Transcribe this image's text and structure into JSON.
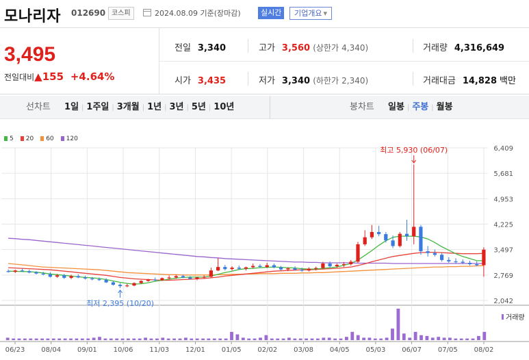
{
  "header": {
    "stock_name": "모나리자",
    "stock_code": "012690",
    "market_badge": "코스피",
    "date": "2024.08.09",
    "date_suffix": "기준(장마감)",
    "realtime_label": "실시간",
    "company_button": "기업개요",
    "company_button_arrow": "▾"
  },
  "quote": {
    "price": "3,495",
    "change_label": "전일대비",
    "change_arrow": "▲",
    "change_value": "155",
    "change_pct": "+4.64%",
    "prev_close_label": "전일",
    "prev_close": "3,340",
    "high_label": "고가",
    "high": "3,560",
    "upper_limit_label": "(상한가",
    "upper_limit": "4,340)",
    "volume_label": "거래량",
    "volume": "4,316,649",
    "open_label": "시가",
    "open": "3,435",
    "low_label": "저가",
    "low": "3,340",
    "lower_limit_label": "(하한가",
    "lower_limit": "2,340)",
    "amount_label": "거래대금",
    "amount": "14,828",
    "amount_unit": "백만"
  },
  "tabs": {
    "line_chart_label": "선차트",
    "line_periods": [
      "1일",
      "1주일",
      "3개월",
      "1년",
      "3년",
      "5년",
      "10년"
    ],
    "candle_label": "봉차트",
    "candle_periods": [
      "일봉",
      "주봉",
      "월봉"
    ],
    "active_candle": "주봉"
  },
  "colors": {
    "up": "#e0211b",
    "down": "#3a7be0",
    "ma5": "#41b83f",
    "ma20": "#e8413a",
    "ma60": "#f4903a",
    "ma120": "#9a64cf",
    "volume": "#9c6bd3",
    "accent": "#3e6fd1"
  },
  "chart_data": {
    "type": "candlestick",
    "interval": "weekly",
    "legend": [
      {
        "name": "5",
        "color": "#41b83f"
      },
      {
        "name": "20",
        "color": "#e8413a"
      },
      {
        "name": "60",
        "color": "#f4903a"
      },
      {
        "name": "120",
        "color": "#9a64cf"
      }
    ],
    "x_tick_labels": [
      "06/23",
      "08/04",
      "09/01",
      "10/06",
      "11/03",
      "12/01",
      "01/05",
      "02/02",
      "03/08",
      "04/05",
      "05/03",
      "06/07",
      "07/05",
      "08/02"
    ],
    "y_tick_labels": [
      "6,409",
      "5,681",
      "4,953",
      "4,225",
      "3,497",
      "2,769",
      "2,042"
    ],
    "ylim": [
      2042,
      6409
    ],
    "annotations": [
      {
        "label": "최고 5,930 (06/07)",
        "value": 5930
      },
      {
        "label": "최저 2,395 (10/20)",
        "value": 2395
      }
    ],
    "volume_label": "거래량",
    "ohlc": [
      {
        "o": 2880,
        "h": 2930,
        "l": 2840,
        "c": 2860
      },
      {
        "o": 2860,
        "h": 2920,
        "l": 2830,
        "c": 2900
      },
      {
        "o": 2900,
        "h": 2960,
        "l": 2860,
        "c": 2880
      },
      {
        "o": 2880,
        "h": 2920,
        "l": 2820,
        "c": 2840
      },
      {
        "o": 2850,
        "h": 2880,
        "l": 2790,
        "c": 2810
      },
      {
        "o": 2810,
        "h": 2860,
        "l": 2760,
        "c": 2790
      },
      {
        "o": 2790,
        "h": 2850,
        "l": 2700,
        "c": 2720
      },
      {
        "o": 2720,
        "h": 2800,
        "l": 2690,
        "c": 2760
      },
      {
        "o": 2760,
        "h": 2800,
        "l": 2660,
        "c": 2690
      },
      {
        "o": 2690,
        "h": 2780,
        "l": 2650,
        "c": 2740
      },
      {
        "o": 2740,
        "h": 2790,
        "l": 2680,
        "c": 2700
      },
      {
        "o": 2700,
        "h": 2750,
        "l": 2640,
        "c": 2670
      },
      {
        "o": 2670,
        "h": 2710,
        "l": 2620,
        "c": 2650
      },
      {
        "o": 2650,
        "h": 2700,
        "l": 2600,
        "c": 2630
      },
      {
        "o": 2630,
        "h": 2680,
        "l": 2540,
        "c": 2560
      },
      {
        "o": 2560,
        "h": 2600,
        "l": 2470,
        "c": 2490
      },
      {
        "o": 2490,
        "h": 2540,
        "l": 2395,
        "c": 2450
      },
      {
        "o": 2450,
        "h": 2520,
        "l": 2420,
        "c": 2470
      },
      {
        "o": 2470,
        "h": 2560,
        "l": 2450,
        "c": 2540
      },
      {
        "o": 2540,
        "h": 2620,
        "l": 2520,
        "c": 2600
      },
      {
        "o": 2600,
        "h": 2660,
        "l": 2580,
        "c": 2640
      },
      {
        "o": 2640,
        "h": 2700,
        "l": 2600,
        "c": 2620
      },
      {
        "o": 2620,
        "h": 2700,
        "l": 2600,
        "c": 2680
      },
      {
        "o": 2680,
        "h": 2760,
        "l": 2640,
        "c": 2700
      },
      {
        "o": 2700,
        "h": 2780,
        "l": 2660,
        "c": 2740
      },
      {
        "o": 2740,
        "h": 2780,
        "l": 2680,
        "c": 2700
      },
      {
        "o": 2700,
        "h": 2740,
        "l": 2640,
        "c": 2660
      },
      {
        "o": 2660,
        "h": 2720,
        "l": 2620,
        "c": 2700
      },
      {
        "o": 2700,
        "h": 2760,
        "l": 2660,
        "c": 2720
      },
      {
        "o": 2720,
        "h": 2980,
        "l": 2700,
        "c": 2900
      },
      {
        "o": 2900,
        "h": 3250,
        "l": 2880,
        "c": 3000
      },
      {
        "o": 3000,
        "h": 3060,
        "l": 2900,
        "c": 2940
      },
      {
        "o": 2940,
        "h": 3020,
        "l": 2900,
        "c": 2980
      },
      {
        "o": 2980,
        "h": 3040,
        "l": 2920,
        "c": 2950
      },
      {
        "o": 2950,
        "h": 3010,
        "l": 2900,
        "c": 2990
      },
      {
        "o": 2990,
        "h": 3100,
        "l": 2960,
        "c": 3030
      },
      {
        "o": 3030,
        "h": 3080,
        "l": 2980,
        "c": 3000
      },
      {
        "o": 3000,
        "h": 3120,
        "l": 2970,
        "c": 3050
      },
      {
        "o": 3050,
        "h": 3100,
        "l": 2960,
        "c": 2990
      },
      {
        "o": 2990,
        "h": 3030,
        "l": 2900,
        "c": 2930
      },
      {
        "o": 2930,
        "h": 2990,
        "l": 2880,
        "c": 2960
      },
      {
        "o": 2960,
        "h": 3020,
        "l": 2900,
        "c": 2920
      },
      {
        "o": 2920,
        "h": 2980,
        "l": 2860,
        "c": 2900
      },
      {
        "o": 2900,
        "h": 2990,
        "l": 2870,
        "c": 2950
      },
      {
        "o": 2950,
        "h": 3010,
        "l": 2900,
        "c": 2970
      },
      {
        "o": 2970,
        "h": 3150,
        "l": 2940,
        "c": 3100
      },
      {
        "o": 3100,
        "h": 3160,
        "l": 2980,
        "c": 3020
      },
      {
        "o": 3020,
        "h": 3100,
        "l": 2980,
        "c": 3060
      },
      {
        "o": 3060,
        "h": 3140,
        "l": 3000,
        "c": 3080
      },
      {
        "o": 3080,
        "h": 3200,
        "l": 3040,
        "c": 3150
      },
      {
        "o": 3150,
        "h": 3720,
        "l": 3120,
        "c": 3650
      },
      {
        "o": 3650,
        "h": 4050,
        "l": 3600,
        "c": 3850
      },
      {
        "o": 3850,
        "h": 4200,
        "l": 3800,
        "c": 4000
      },
      {
        "o": 4000,
        "h": 4180,
        "l": 3880,
        "c": 3940
      },
      {
        "o": 3940,
        "h": 4000,
        "l": 3700,
        "c": 3760
      },
      {
        "o": 3760,
        "h": 3900,
        "l": 3540,
        "c": 3600
      },
      {
        "o": 3600,
        "h": 4000,
        "l": 3560,
        "c": 3950
      },
      {
        "o": 3950,
        "h": 4350,
        "l": 3750,
        "c": 3880
      },
      {
        "o": 3880,
        "h": 5930,
        "l": 3650,
        "c": 4150
      },
      {
        "o": 4150,
        "h": 4200,
        "l": 3350,
        "c": 3450
      },
      {
        "o": 3450,
        "h": 3600,
        "l": 3300,
        "c": 3400
      },
      {
        "o": 3400,
        "h": 3500,
        "l": 3300,
        "c": 3350
      },
      {
        "o": 3350,
        "h": 3400,
        "l": 3150,
        "c": 3200
      },
      {
        "o": 3200,
        "h": 3280,
        "l": 3120,
        "c": 3160
      },
      {
        "o": 3160,
        "h": 3250,
        "l": 3100,
        "c": 3150
      },
      {
        "o": 3150,
        "h": 3220,
        "l": 3080,
        "c": 3120
      },
      {
        "o": 3120,
        "h": 3180,
        "l": 3040,
        "c": 3080
      },
      {
        "o": 3080,
        "h": 3160,
        "l": 3020,
        "c": 3050
      },
      {
        "o": 3050,
        "h": 3560,
        "l": 2720,
        "c": 3495
      }
    ],
    "ma5": [
      2880,
      2875,
      2870,
      2865,
      2850,
      2830,
      2800,
      2780,
      2760,
      2740,
      2720,
      2700,
      2690,
      2670,
      2640,
      2600,
      2560,
      2530,
      2510,
      2520,
      2550,
      2590,
      2620,
      2650,
      2680,
      2700,
      2710,
      2710,
      2710,
      2740,
      2790,
      2840,
      2880,
      2930,
      2950,
      2960,
      2980,
      2990,
      3000,
      2990,
      2980,
      2970,
      2950,
      2940,
      2940,
      2960,
      2980,
      3000,
      3050,
      3100,
      3200,
      3330,
      3470,
      3620,
      3750,
      3850,
      3880,
      3880,
      3880,
      3860,
      3800,
      3700,
      3580,
      3480,
      3380,
      3300,
      3240,
      3180,
      3180
    ],
    "ma20": [
      2980,
      2970,
      2960,
      2950,
      2940,
      2930,
      2920,
      2900,
      2880,
      2860,
      2840,
      2820,
      2800,
      2780,
      2760,
      2730,
      2700,
      2680,
      2660,
      2650,
      2640,
      2630,
      2620,
      2620,
      2630,
      2640,
      2650,
      2660,
      2670,
      2690,
      2710,
      2740,
      2760,
      2780,
      2800,
      2820,
      2840,
      2860,
      2880,
      2890,
      2900,
      2910,
      2920,
      2920,
      2930,
      2940,
      2950,
      2960,
      2980,
      3000,
      3040,
      3090,
      3150,
      3200,
      3250,
      3300,
      3330,
      3360,
      3390,
      3410,
      3420,
      3420,
      3410,
      3400,
      3390,
      3380,
      3380,
      3380,
      3390
    ],
    "ma60": [
      3100,
      3080,
      3060,
      3040,
      3020,
      3000,
      2990,
      2980,
      2970,
      2960,
      2950,
      2940,
      2930,
      2920,
      2900,
      2880,
      2860,
      2840,
      2830,
      2820,
      2810,
      2800,
      2790,
      2780,
      2780,
      2770,
      2770,
      2770,
      2770,
      2770,
      2780,
      2780,
      2790,
      2790,
      2800,
      2800,
      2810,
      2810,
      2810,
      2820,
      2820,
      2820,
      2830,
      2830,
      2840,
      2840,
      2850,
      2860,
      2870,
      2880,
      2890,
      2900,
      2910,
      2920,
      2930,
      2940,
      2950,
      2960,
      2970,
      2980,
      2990,
      3000,
      3000,
      3010,
      3010,
      3020,
      3020,
      3030,
      3040
    ],
    "ma120": [
      3820,
      3810,
      3790,
      3780,
      3760,
      3740,
      3720,
      3700,
      3680,
      3660,
      3640,
      3620,
      3600,
      3580,
      3560,
      3540,
      3520,
      3500,
      3480,
      3460,
      3440,
      3420,
      3400,
      3380,
      3360,
      3340,
      3320,
      3300,
      3290,
      3270,
      3260,
      3240,
      3230,
      3220,
      3210,
      3200,
      3190,
      3180,
      3170,
      3160,
      3150,
      3140,
      3140,
      3130,
      3130,
      3120,
      3120,
      3120,
      3120,
      3120,
      3110,
      3110,
      3110,
      3110,
      3110,
      3100,
      3100,
      3100,
      3100,
      3100,
      3100,
      3100,
      3100,
      3100,
      3100,
      3100,
      3100,
      3100,
      3100
    ],
    "volume": [
      3,
      2,
      2,
      2,
      2,
      2,
      2,
      2,
      2,
      2,
      2,
      2,
      2,
      2,
      2,
      3,
      4,
      2,
      2,
      2,
      2,
      2,
      2,
      2,
      3,
      2,
      2,
      3,
      2,
      2,
      2,
      3,
      2,
      2,
      2,
      2,
      2,
      2,
      2,
      10,
      7,
      3,
      2,
      2,
      3,
      6,
      2,
      2,
      2,
      3,
      2,
      2,
      2,
      2,
      2,
      3,
      3,
      2,
      2,
      4,
      10,
      6,
      3,
      3,
      2,
      2,
      3,
      14,
      38,
      8,
      3,
      10,
      6,
      5,
      3,
      4,
      3,
      3,
      2,
      2,
      2,
      2,
      5,
      10
    ]
  }
}
